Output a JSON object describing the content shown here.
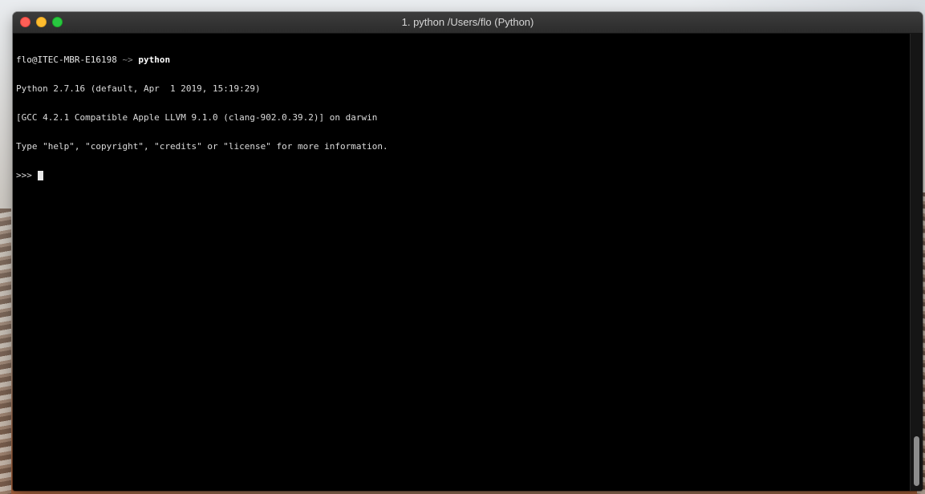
{
  "window": {
    "title": "1. python /Users/flo (Python)"
  },
  "terminal": {
    "prompt_host": "flo@ITEC-MBR-E16198",
    "prompt_symbol": " ~> ",
    "command": "python",
    "output_lines": [
      "Python 2.7.16 (default, Apr  1 2019, 15:19:29)",
      "[GCC 4.2.1 Compatible Apple LLVM 9.1.0 (clang-902.0.39.2)] on darwin",
      "Type \"help\", \"copyright\", \"credits\" or \"license\" for more information."
    ],
    "repl_prompt": ">>> "
  },
  "colors": {
    "close_button": "#ff5f57",
    "minimize_button": "#febc2e",
    "maximize_button": "#28c840",
    "terminal_background": "#000000"
  }
}
